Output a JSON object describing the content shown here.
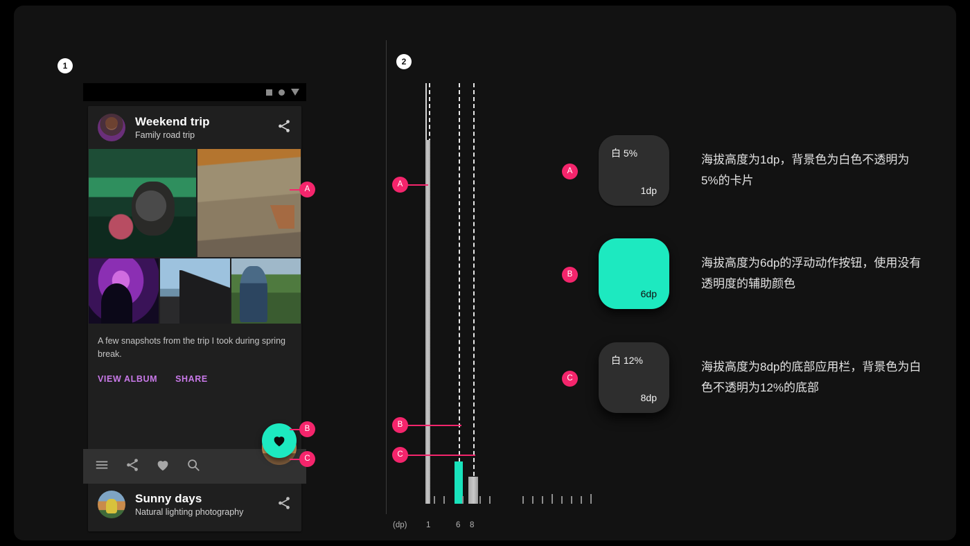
{
  "sections": [
    {
      "number": "1"
    },
    {
      "number": "2"
    }
  ],
  "colors": {
    "background": "#121212",
    "accent_teal": "#1de9c0",
    "marker_pink": "#f4256c",
    "card_surface": "#1f1f1f",
    "bottom_bar": "#313131",
    "action_link": "#c879e8"
  },
  "phone": {
    "status_icons": [
      "square-icon",
      "circle-icon",
      "triangle-down-icon"
    ],
    "cards": [
      {
        "title": "Weekend trip",
        "subtitle": "Family road trip",
        "share_icon": "share-icon",
        "body": "A few snapshots from the trip I took during spring break.",
        "actions": [
          "VIEW ALBUM",
          "SHARE"
        ],
        "photos": [
          "pig-photo",
          "chalk-wall-photo",
          "night-silhouette-photo",
          "roadside-photo",
          "herder-photo"
        ]
      },
      {
        "title": "Sunny days",
        "subtitle": "Natural lighting photography",
        "share_icon": "share-icon"
      }
    ],
    "bottom_bar_icons": [
      "menu-icon",
      "share-icon",
      "heart-icon",
      "search-icon"
    ],
    "fab": {
      "icon": "heart-icon",
      "color": "#1de9c0"
    }
  },
  "markers": {
    "phone": [
      {
        "label": "A"
      },
      {
        "label": "B"
      },
      {
        "label": "C"
      }
    ],
    "scale": [
      {
        "label": "A"
      },
      {
        "label": "B"
      },
      {
        "label": "C"
      }
    ],
    "legend": [
      {
        "label": "A"
      },
      {
        "label": "B"
      },
      {
        "label": "C"
      }
    ]
  },
  "chart_data": {
    "type": "bar",
    "title": "",
    "xlabel": "(dp)",
    "ylabel": "",
    "axis_unit_label": "(dp)",
    "categories": [
      "1",
      "6",
      "8"
    ],
    "tick_labels": [
      "1",
      "6",
      "8"
    ],
    "values": [
      1,
      6,
      8
    ],
    "series": [
      {
        "name": "1dp card",
        "value": 1,
        "color": "#c9c9c9",
        "height_ratio": 1.0
      },
      {
        "name": "6dp floating action button",
        "value": 6,
        "color": "#19e3bc",
        "height_ratio": 0.116
      },
      {
        "name": "8dp bottom app bar",
        "value": 8,
        "color": "#c9c9c9",
        "height_ratio": 0.074
      }
    ],
    "gridlines": "dashed vertical at 1dp, 6dp, 8dp",
    "legend_position": "right",
    "notes": "Vertical elevation ruler; bar width encodes dp elevation, dashed lines mark 1, 6 and 8 dp."
  },
  "legend": [
    {
      "marker": "A",
      "swatch_top_label": "白 5%",
      "swatch_bottom_label": "1dp",
      "swatch_kind": "dark",
      "description": "海拔高度为1dp，背景色为白色不透明为5%的卡片"
    },
    {
      "marker": "B",
      "swatch_top_label": "",
      "swatch_bottom_label": "6dp",
      "swatch_kind": "teal",
      "description": "海拔高度为6dp的浮动动作按钮，使用没有透明度的辅助颜色"
    },
    {
      "marker": "C",
      "swatch_top_label": "白 12%",
      "swatch_bottom_label": "8dp",
      "swatch_kind": "dark",
      "description": "海拔高度为8dp的底部应用栏，背景色为白色不透明为12%的底部"
    }
  ]
}
